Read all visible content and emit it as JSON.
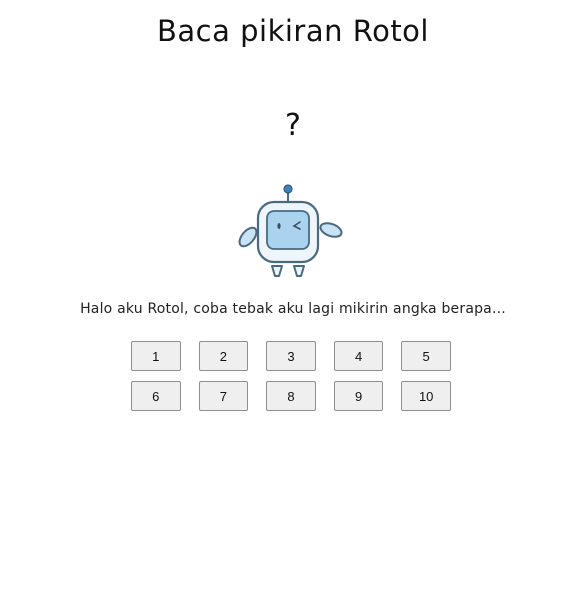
{
  "title": "Baca pikiran Rotol",
  "guess_display": "?",
  "mascot_icon": "robot-winking-icon",
  "message": "Halo aku Rotol, coba tebak aku lagi mikirin angka berapa...",
  "number_buttons": {
    "row1": [
      "1",
      "2",
      "3",
      "4",
      "5"
    ],
    "row2": [
      "6",
      "7",
      "8",
      "9",
      "10"
    ]
  },
  "colors": {
    "robot_body": "#a9d3ee",
    "robot_outline": "#4a6a80",
    "robot_antenna": "#3f83b8",
    "button_bg": "#efefef",
    "button_border": "#8f8f8f"
  }
}
